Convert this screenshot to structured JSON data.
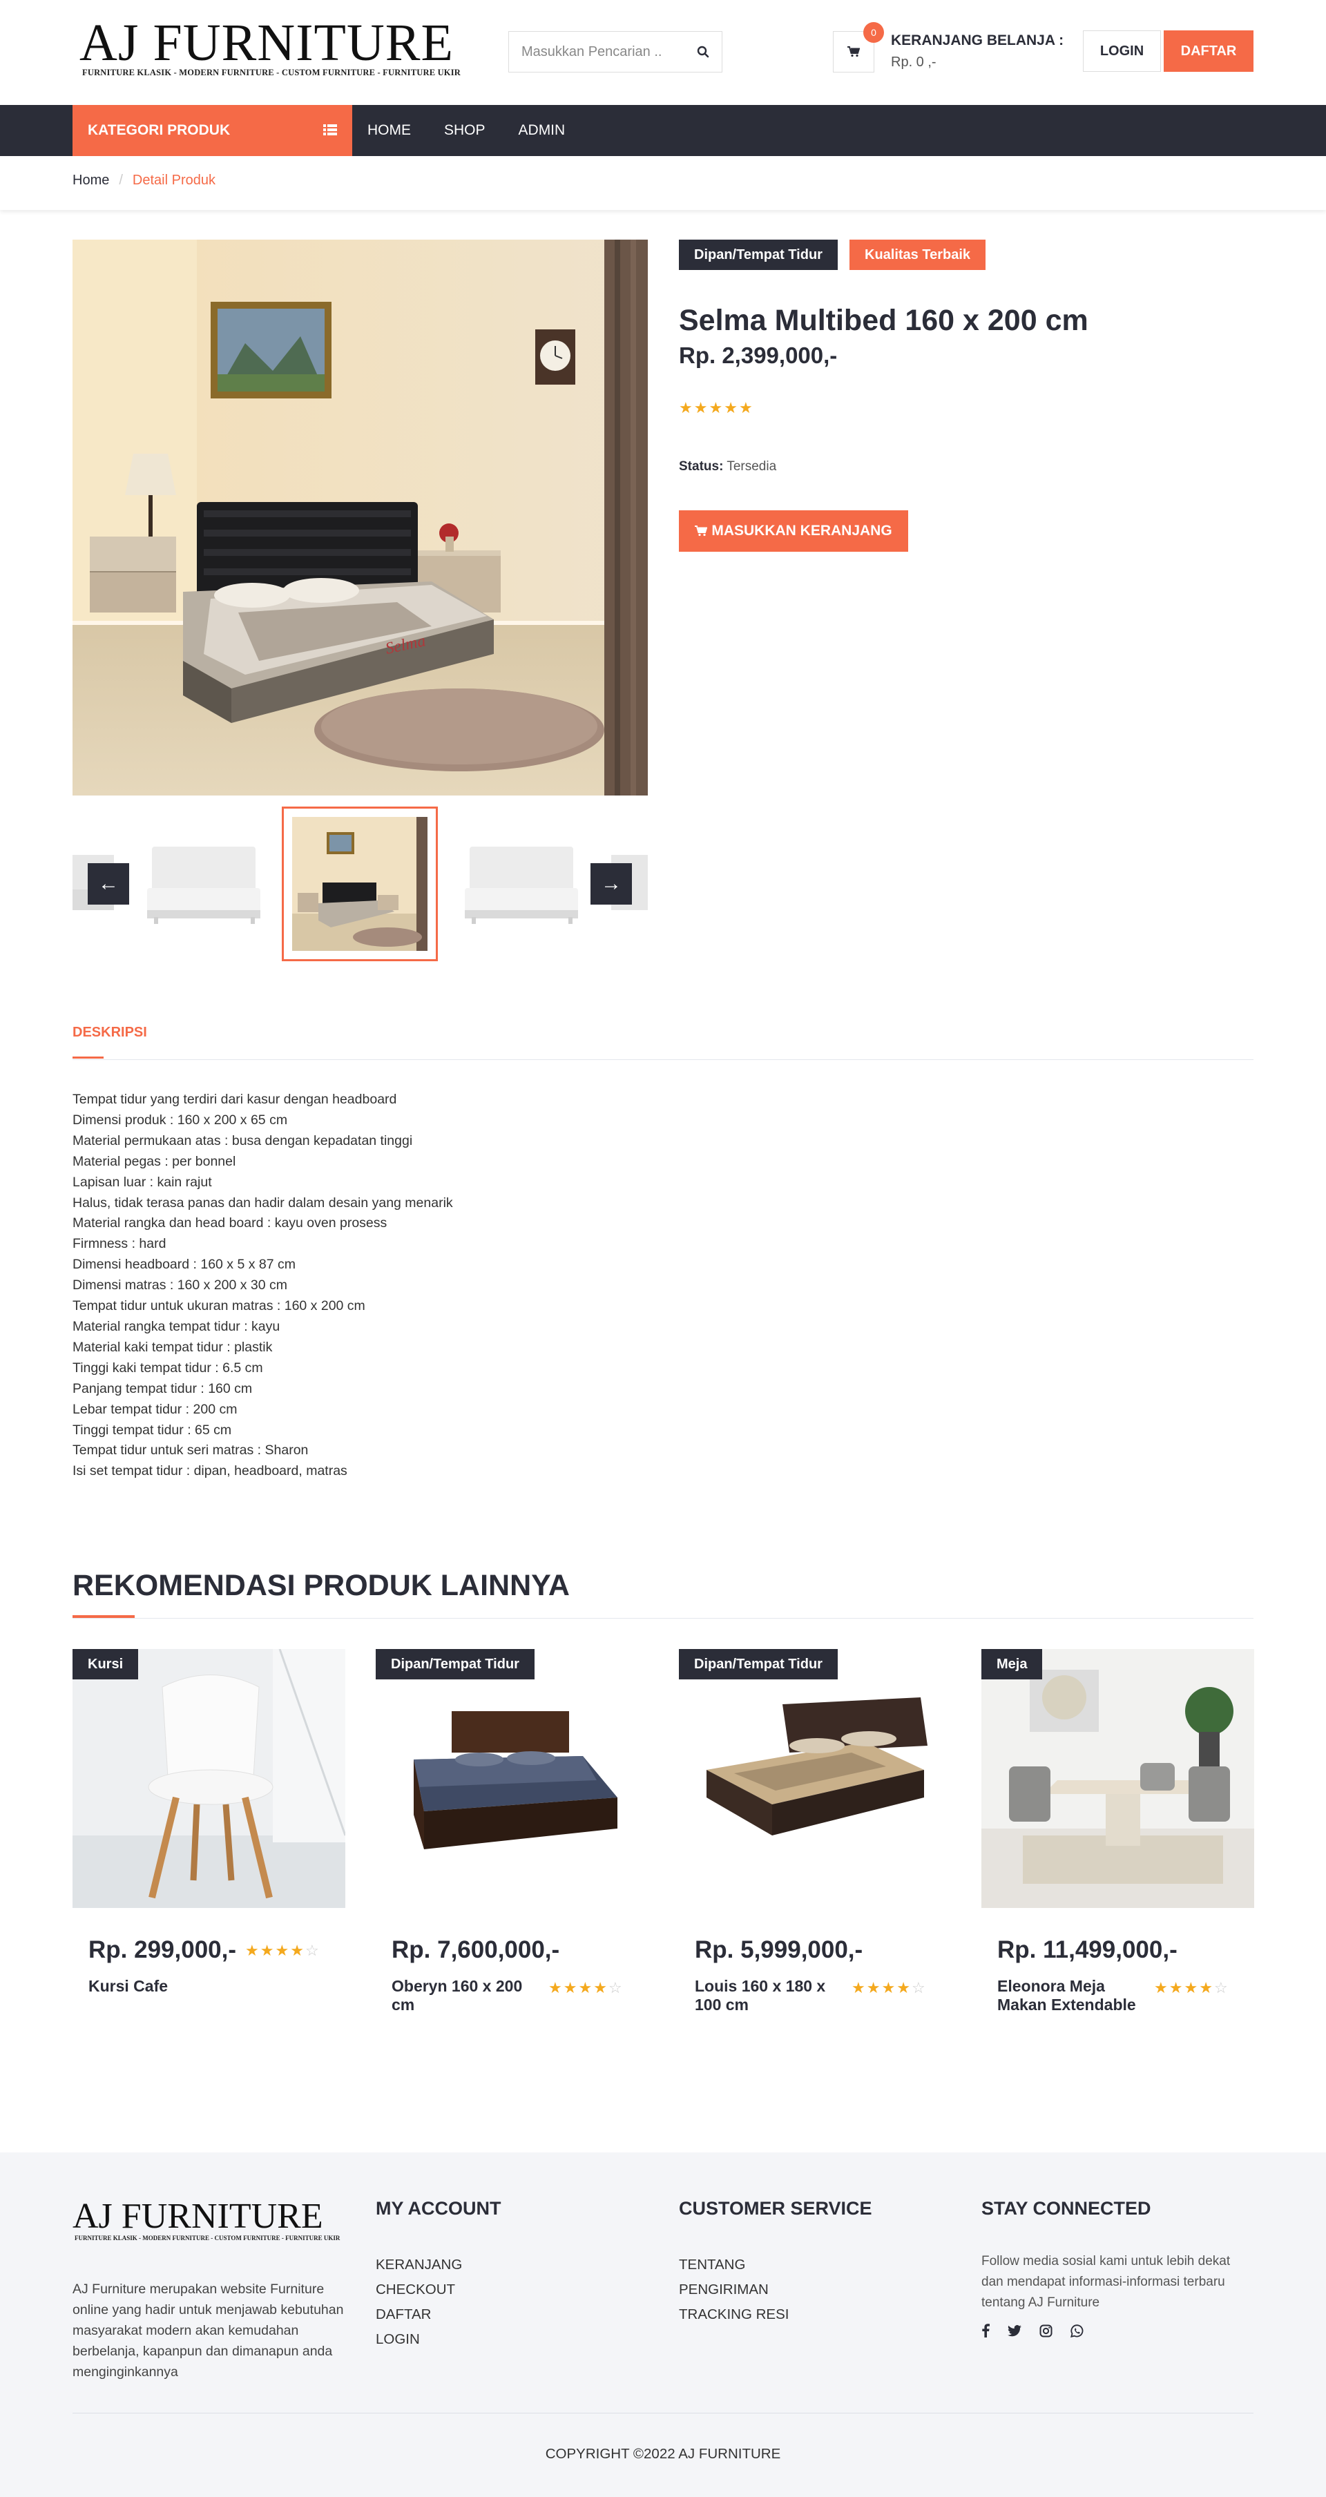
{
  "brand": {
    "logo_text": "AJ FURNITURE",
    "tagline": "FURNITURE KLASIK - MODERN FURNITURE - CUSTOM FURNITURE - FURNITURE UKIR"
  },
  "header": {
    "search_placeholder": "Masukkan Pencarian ..",
    "cart_count": "0",
    "cart_title": "KERANJANG BELANJA :",
    "cart_total": "Rp. 0 ,-",
    "login_label": "LOGIN",
    "register_label": "DAFTAR"
  },
  "nav": {
    "category_label": "KATEGORI PRODUK",
    "links": [
      "HOME",
      "SHOP",
      "ADMIN"
    ]
  },
  "breadcrumb": {
    "home": "Home",
    "separator": "/",
    "current": "Detail Produk"
  },
  "product": {
    "category_tag": "Dipan/Tempat Tidur",
    "quality_tag": "Kualitas Terbaik",
    "title": "Selma Multibed 160 x 200 cm",
    "price": "Rp. 2,399,000,-",
    "rating": 5,
    "status_label": "Status:",
    "status_value": "Tersedia",
    "add_to_cart_label": "MASUKKAN KERANJANG",
    "bed_brand_text": "Selma",
    "thumb_prev": "←",
    "thumb_next": "→"
  },
  "description": {
    "tab_label": "DESKRIPSI",
    "lines": [
      "Tempat tidur yang terdiri dari kasur dengan headboard",
      "Dimensi produk : 160 x 200 x 65 cm",
      "Material permukaan atas : busa dengan kepadatan tinggi",
      "Material pegas : per bonnel",
      "Lapisan luar : kain rajut",
      "Halus, tidak terasa panas dan hadir dalam desain yang menarik",
      "Material rangka dan head board : kayu oven prosess",
      "Firmness : hard",
      "Dimensi headboard : 160 x 5 x 87 cm",
      "Dimensi matras : 160 x 200 x 30 cm",
      "Tempat tidur untuk ukuran matras : 160 x 200 cm",
      "Material rangka tempat tidur : kayu",
      "Material kaki tempat tidur : plastik",
      "Tinggi kaki tempat tidur : 6.5 cm",
      "Panjang tempat tidur : 160 cm",
      "Lebar tempat tidur : 200 cm",
      "Tinggi tempat tidur : 65 cm",
      "Tempat tidur untuk seri matras : Sharon",
      "Isi set tempat tidur : dipan, headboard, matras"
    ]
  },
  "recommendations": {
    "title": "REKOMENDASI PRODUK LAINNYA",
    "items": [
      {
        "category": "Kursi",
        "price": "Rp. 299,000,-",
        "name": "Kursi Cafe",
        "rating": 4
      },
      {
        "category": "Dipan/Tempat Tidur",
        "price": "Rp. 7,600,000,-",
        "name": "Oberyn 160 x 200 cm",
        "rating": 4
      },
      {
        "category": "Dipan/Tempat Tidur",
        "price": "Rp. 5,999,000,-",
        "name": "Louis 160 x 180 x 100 cm",
        "rating": 4
      },
      {
        "category": "Meja",
        "price": "Rp. 11,499,000,-",
        "name": "Eleonora Meja Makan Extendable",
        "rating": 4
      }
    ]
  },
  "footer": {
    "about": "AJ Furniture merupakan website Furniture online yang hadir untuk menjawab kebutuhan masyarakat modern akan kemudahan berbelanja, kapanpun dan dimanapun anda menginginkannya",
    "my_account_title": "MY ACCOUNT",
    "my_account_links": [
      "KERANJANG",
      "CHECKOUT",
      "DAFTAR",
      "LOGIN"
    ],
    "customer_service_title": "CUSTOMER SERVICE",
    "customer_service_links": [
      "TENTANG",
      "PENGIRIMAN",
      "TRACKING RESI"
    ],
    "stay_connected_title": "STAY CONNECTED",
    "stay_connected_text": "Follow media sosial kami untuk lebih dekat dan mendapat informasi-informasi terbaru tentang AJ Furniture",
    "social_icons": [
      "facebook-icon",
      "twitter-icon",
      "instagram-icon",
      "whatsapp-icon"
    ],
    "copyright": "COPYRIGHT ©2022 AJ FURNITURE"
  },
  "colors": {
    "accent": "#f56a47",
    "dark": "#2b2d38",
    "star": "#f4a91e",
    "footer_bg": "#f4f5f8"
  }
}
